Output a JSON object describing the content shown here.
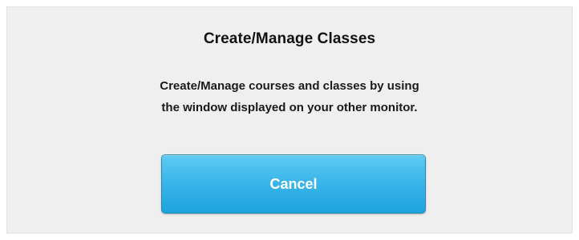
{
  "dialog": {
    "title": "Create/Manage Classes",
    "message_line1": "Create/Manage courses and classes by using",
    "message_line2": "the window displayed on your other monitor.",
    "cancel_label": "Cancel"
  },
  "colors": {
    "dialog_background": "#efefef",
    "button_top": "#5fcbf3",
    "button_bottom": "#1ea3dd",
    "button_text": "#ffffff"
  }
}
